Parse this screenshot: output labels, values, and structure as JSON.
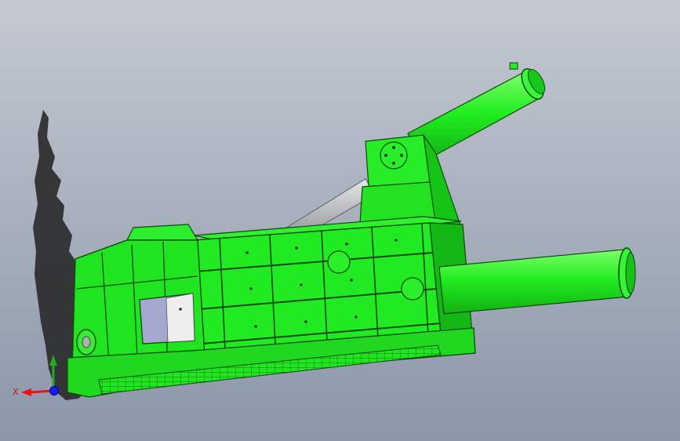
{
  "viewport": {
    "background_top": "#c4c9d1",
    "background_bottom": "#8b96a8"
  },
  "model": {
    "body_color": "#22ee22",
    "body_shade": "#11b511",
    "edge_color": "#0a4a0a",
    "rod_color": "#b9bcc0",
    "shadow_color": "#2b2b2b"
  },
  "triad": {
    "x_label": "X",
    "x_color": "#ee1111",
    "y_color": "#22aa22",
    "z_color": "#1a1aff"
  }
}
